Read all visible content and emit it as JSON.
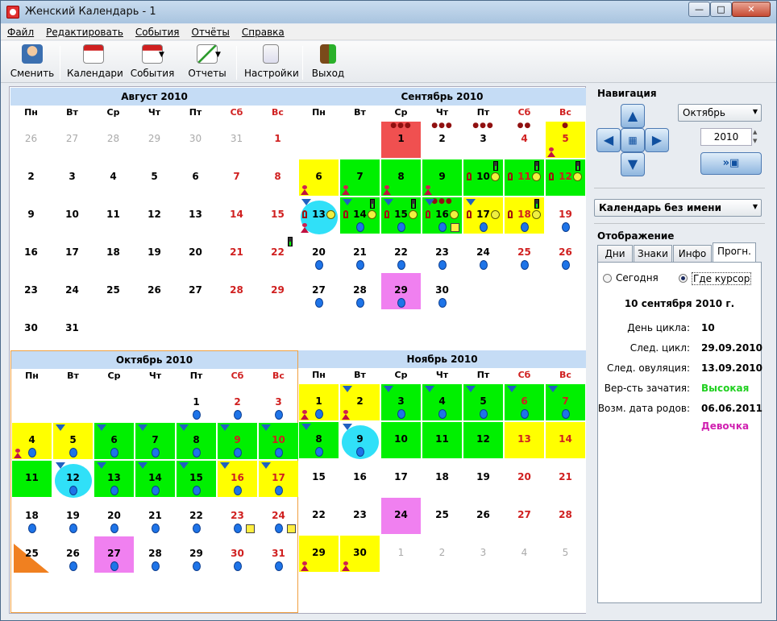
{
  "window": {
    "title": "Женский Календарь - 1",
    "min": "—",
    "max": "□",
    "close": "✕"
  },
  "menu": [
    "Файл",
    "Редактировать",
    "События",
    "Отчёты",
    "Справка"
  ],
  "toolbar": [
    {
      "label": "Сменить",
      "icon": "user-icon"
    },
    {
      "label": "Календари",
      "icon": "calendar-icon"
    },
    {
      "label": "События",
      "icon": "events-icon"
    },
    {
      "label": "Отчеты",
      "icon": "chart-icon"
    },
    {
      "label": "Настройки",
      "icon": "settings-icon"
    },
    {
      "label": "Выход",
      "icon": "exit-icon"
    }
  ],
  "weekdays": [
    "Пн",
    "Вт",
    "Ср",
    "Чт",
    "Пт",
    "Сб",
    "Вс"
  ],
  "colors": {
    "yellow": "#ffff00",
    "green": "#00f000",
    "red": "#f05050",
    "pink": "#f080f0",
    "cyan": "#30e0f8",
    "blue": "#1e74e8",
    "header": "#c5dcf5"
  },
  "months": [
    {
      "title": "Август 2010",
      "selected": false,
      "weeks": [
        [
          [
            "26",
            "dim"
          ],
          [
            "27",
            "dim"
          ],
          [
            "28",
            "dim"
          ],
          [
            "29",
            "dim"
          ],
          [
            "30",
            "dim"
          ],
          [
            "31",
            "dim"
          ],
          [
            "1",
            "we"
          ]
        ],
        [
          [
            "2"
          ],
          [
            "3"
          ],
          [
            "4"
          ],
          [
            "5"
          ],
          [
            "6"
          ],
          [
            "7",
            "we"
          ],
          [
            "8",
            "we"
          ]
        ],
        [
          [
            "9"
          ],
          [
            "10"
          ],
          [
            "11"
          ],
          [
            "12"
          ],
          [
            "13"
          ],
          [
            "14",
            "we"
          ],
          [
            "15",
            "we"
          ]
        ],
        [
          [
            "16"
          ],
          [
            "17"
          ],
          [
            "18"
          ],
          [
            "19"
          ],
          [
            "20"
          ],
          [
            "21",
            "we"
          ],
          [
            "22",
            "we bat"
          ]
        ],
        [
          [
            "23"
          ],
          [
            "24"
          ],
          [
            "25"
          ],
          [
            "26"
          ],
          [
            "27"
          ],
          [
            "28",
            "we"
          ],
          [
            "29",
            "we"
          ]
        ],
        [
          [
            "30"
          ],
          [
            "31"
          ]
        ]
      ]
    },
    {
      "title": "Сентябрь 2010",
      "selected": false,
      "weeks": [
        [
          [
            ""
          ],
          [
            ""
          ],
          [
            "1",
            "red dots5"
          ],
          [
            "2",
            "dots4"
          ],
          [
            "3",
            "dots3"
          ],
          [
            "4",
            "we dots2"
          ],
          [
            "5",
            "we yellow dots1 fem"
          ]
        ],
        [
          [
            "6",
            "yellow fem"
          ],
          [
            "7",
            "green fem"
          ],
          [
            "8",
            "green fem"
          ],
          [
            "9",
            "green fem"
          ],
          [
            "10",
            "green key smile bat"
          ],
          [
            "11",
            "we green key smile bat"
          ],
          [
            "12",
            "we green key smile bat"
          ]
        ],
        [
          [
            "13",
            "circ arr key smile fem"
          ],
          [
            "14",
            "green arr key smile bat dot"
          ],
          [
            "15",
            "green arr key smile bat dot"
          ],
          [
            "16",
            "green arr key smile dots5 dot note"
          ],
          [
            "17",
            "yellow arr key smile dot"
          ],
          [
            "18",
            "we yellow key smile bat dot"
          ],
          [
            "19",
            "we dot"
          ]
        ],
        [
          [
            "20",
            "dot"
          ],
          [
            "21",
            "dot"
          ],
          [
            "22",
            "dot"
          ],
          [
            "23",
            "dot"
          ],
          [
            "24",
            "dot"
          ],
          [
            "25",
            "we dot"
          ],
          [
            "26",
            "we dot"
          ]
        ],
        [
          [
            "27",
            "dot"
          ],
          [
            "28",
            "dot"
          ],
          [
            "29",
            "pink dot"
          ],
          [
            "30",
            "dot"
          ]
        ],
        []
      ]
    },
    {
      "title": "Октябрь 2010",
      "selected": true,
      "weeks": [
        [
          [
            ""
          ],
          [
            ""
          ],
          [
            ""
          ],
          [
            ""
          ],
          [
            "1",
            "dot"
          ],
          [
            "2",
            "we dot"
          ],
          [
            "3",
            "we dot"
          ]
        ],
        [
          [
            "4",
            "yellow fem dot"
          ],
          [
            "5",
            "yellow arr dot"
          ],
          [
            "6",
            "green arr dot"
          ],
          [
            "7",
            "green arr dot"
          ],
          [
            "8",
            "green arr dot"
          ],
          [
            "9",
            "we green arr dot"
          ],
          [
            "10",
            "we green arr dot"
          ]
        ],
        [
          [
            "11",
            "green"
          ],
          [
            "12",
            "circ arr dot"
          ],
          [
            "13",
            "green arr dot"
          ],
          [
            "14",
            "green arr dot"
          ],
          [
            "15",
            "green arr dot"
          ],
          [
            "16",
            "we yellow arr dot"
          ],
          [
            "17",
            "we yellow arr dot"
          ]
        ],
        [
          [
            "18",
            "dot"
          ],
          [
            "19",
            "dot"
          ],
          [
            "20",
            "dot"
          ],
          [
            "21",
            "dot"
          ],
          [
            "22",
            "dot"
          ],
          [
            "23",
            "we dot note"
          ],
          [
            "24",
            "we dot note"
          ]
        ],
        [
          [
            "25",
            "corner"
          ],
          [
            "26",
            "dot"
          ],
          [
            "27",
            "pink dot"
          ],
          [
            "28",
            "dot"
          ],
          [
            "29",
            "dot"
          ],
          [
            "30",
            "we dot"
          ],
          [
            "31",
            "we dot"
          ]
        ],
        []
      ]
    },
    {
      "title": "Ноябрь 2010",
      "selected": false,
      "weeks": [
        [
          [
            "1",
            "yellow fem dot"
          ],
          [
            "2",
            "yellow arr fem"
          ],
          [
            "3",
            "green arr dot"
          ],
          [
            "4",
            "green arr dot"
          ],
          [
            "5",
            "green arr dot"
          ],
          [
            "6",
            "we green arr dot"
          ],
          [
            "7",
            "we green arr dot"
          ]
        ],
        [
          [
            "8",
            "green arr dot"
          ],
          [
            "9",
            "circ arr dot"
          ],
          [
            "10",
            "green"
          ],
          [
            "11",
            "green"
          ],
          [
            "12",
            "green"
          ],
          [
            "13",
            "we yellow"
          ],
          [
            "14",
            "we yellow"
          ]
        ],
        [
          [
            "15"
          ],
          [
            "16"
          ],
          [
            "17"
          ],
          [
            "18"
          ],
          [
            "19"
          ],
          [
            "20",
            "we"
          ],
          [
            "21",
            "we"
          ]
        ],
        [
          [
            "22"
          ],
          [
            "23"
          ],
          [
            "24",
            "pink"
          ],
          [
            "25"
          ],
          [
            "26"
          ],
          [
            "27",
            "we"
          ],
          [
            "28",
            "we"
          ]
        ],
        [
          [
            "29",
            "yellow fem"
          ],
          [
            "30",
            "yellow fem"
          ],
          [
            "1",
            "dim"
          ],
          [
            "2",
            "dim"
          ],
          [
            "3",
            "dim"
          ],
          [
            "4",
            "dim"
          ],
          [
            "5",
            "dim"
          ]
        ],
        []
      ]
    }
  ],
  "side": {
    "nav_title": "Навигация",
    "month_select": "Октябрь",
    "year": "2010",
    "calendar_select": "Календарь без имени",
    "display_title": "Отображение",
    "tabs": [
      "Дни",
      "Знаки",
      "Инфо",
      "Прогн."
    ],
    "radio_today": "Сегодня",
    "radio_cursor": "Где курсор",
    "date": "10 сентября 2010 г.",
    "rows": [
      {
        "label": "День цикла:",
        "value": "10",
        "color": "#000000"
      },
      {
        "label": "След. цикл:",
        "value": "29.09.2010",
        "color": "#000000"
      },
      {
        "label": "След. овуляция:",
        "value": "13.09.2010",
        "color": "#000000"
      },
      {
        "label": "Вер-сть зачатия:",
        "value": "Высокая",
        "color": "#20d020"
      },
      {
        "label": "Возм. дата родов:",
        "value": "06.06.2011",
        "color": "#000000"
      }
    ],
    "gender": "Девочка",
    "gender_color": "#d020b0"
  }
}
